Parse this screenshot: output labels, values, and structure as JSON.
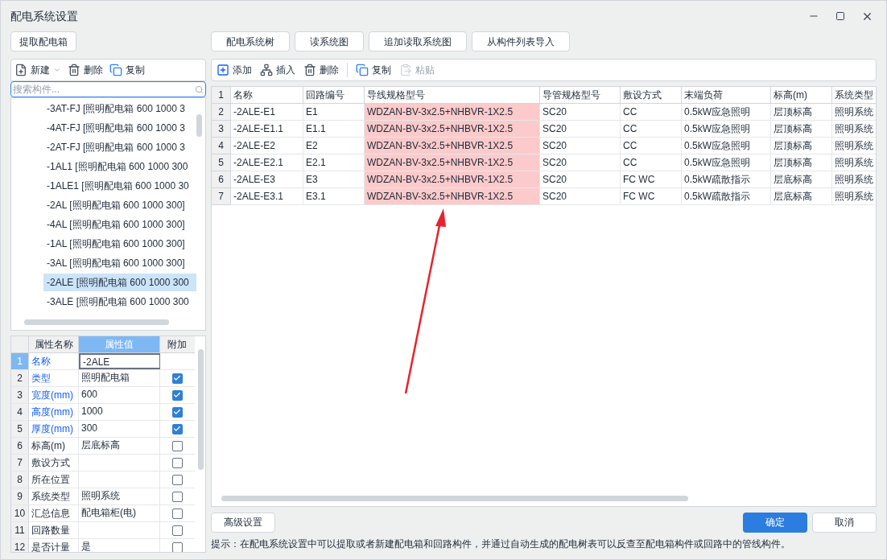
{
  "window": {
    "title": "配电系统设置"
  },
  "left": {
    "extract_button": "提取配电箱",
    "toolbar": [
      {
        "kind": "new",
        "label": "新建",
        "dropdown": true
      },
      {
        "kind": "delete",
        "label": "删除",
        "dropdown": false
      },
      {
        "kind": "copy",
        "label": "复制",
        "dropdown": false
      }
    ],
    "search": {
      "placeholder": "搜索构件..."
    },
    "tree": [
      {
        "label": "-3AT-FJ [照明配电箱 600 1000 3",
        "selected": false
      },
      {
        "label": "-4AT-FJ [照明配电箱 600 1000 3",
        "selected": false
      },
      {
        "label": "-2AT-FJ [照明配电箱 600 1000 3",
        "selected": false
      },
      {
        "label": "-1AL1 [照明配电箱 600 1000 300",
        "selected": false
      },
      {
        "label": "-1ALE1 [照明配电箱 600 1000 30",
        "selected": false
      },
      {
        "label": "-2AL [照明配电箱 600 1000 300]",
        "selected": false
      },
      {
        "label": "-4AL [照明配电箱 600 1000 300]",
        "selected": false
      },
      {
        "label": "-1AL [照明配电箱 600 1000 300]",
        "selected": false
      },
      {
        "label": "-3AL [照明配电箱 600 1000 300]",
        "selected": false
      },
      {
        "label": "-2ALE [照明配电箱 600 1000 300",
        "selected": true
      },
      {
        "label": "-3ALE [照明配电箱 600 1000 300",
        "selected": false
      }
    ],
    "properties": {
      "columns": [
        "属性名称",
        "属性值",
        "附加"
      ],
      "rows": [
        {
          "index": "1",
          "name": "名称",
          "value": "-2ALE",
          "required": true,
          "selected": true
        },
        {
          "index": "2",
          "name": "类型",
          "value": "照明配电箱",
          "required": true,
          "checked": true,
          "selected": false
        },
        {
          "index": "3",
          "name": "宽度(mm)",
          "value": "600",
          "required": true,
          "checked": true,
          "selected": false
        },
        {
          "index": "4",
          "name": "高度(mm)",
          "value": "1000",
          "required": true,
          "checked": true,
          "selected": false
        },
        {
          "index": "5",
          "name": "厚度(mm)",
          "value": "300",
          "required": true,
          "checked": true,
          "selected": false
        },
        {
          "index": "6",
          "name": "标高(m)",
          "value": "层底标高",
          "required": false,
          "checked": false,
          "selected": false
        },
        {
          "index": "7",
          "name": "敷设方式",
          "required": false,
          "checked": false,
          "selected": false
        },
        {
          "index": "8",
          "name": "所在位置",
          "required": false,
          "checked": false,
          "selected": false
        },
        {
          "index": "9",
          "name": "系统类型",
          "value": "照明系统",
          "required": false,
          "checked": false,
          "selected": false
        },
        {
          "index": "10",
          "name": "汇总信息",
          "value": "配电箱柜(电)",
          "required": false,
          "checked": false,
          "selected": false
        },
        {
          "index": "11",
          "name": "回路数量",
          "required": false,
          "checked": false,
          "selected": false
        },
        {
          "index": "12",
          "name": "是否计量",
          "value": "是",
          "required": false,
          "checked": false,
          "selected": false
        }
      ]
    }
  },
  "right": {
    "top_buttons": [
      "配电系统树",
      "读系统图",
      "追加读取系统图",
      "从构件列表导入"
    ],
    "toolbar": [
      {
        "kind": "add",
        "label": "添加",
        "disabled": false
      },
      {
        "kind": "insert",
        "label": "插入",
        "disabled": false
      },
      {
        "kind": "delete",
        "label": "删除",
        "disabled": false
      },
      {
        "kind": "copy",
        "label": "复制",
        "disabled": false
      },
      {
        "kind": "paste",
        "label": "粘贴",
        "disabled": true
      }
    ],
    "table": {
      "header_index": "1",
      "columns": [
        {
          "label": "名称",
          "highlighted": false
        },
        {
          "label": "回路编号",
          "highlighted": false
        },
        {
          "label": "导线规格型号",
          "highlighted": true
        },
        {
          "label": "导管规格型号",
          "highlighted": false
        },
        {
          "label": "敷设方式",
          "highlighted": false
        },
        {
          "label": "末端负荷",
          "highlighted": false
        },
        {
          "label": "标高(m)",
          "highlighted": false
        },
        {
          "label": "系统类型",
          "highlighted": false
        }
      ],
      "rows": [
        {
          "index": "2",
          "cells": [
            "-2ALE-E1",
            "E1",
            "WDZAN-BV-3x2.5+NHBVR-1X2.5",
            "SC20",
            "CC",
            "0.5kW应急照明",
            "层顶标高",
            "照明系统"
          ]
        },
        {
          "index": "3",
          "cells": [
            "-2ALE-E1.1",
            "E1.1",
            "WDZAN-BV-3x2.5+NHBVR-1X2.5",
            "SC20",
            "CC",
            "0.5kW应急照明",
            "层顶标高",
            "照明系统"
          ]
        },
        {
          "index": "4",
          "cells": [
            "-2ALE-E2",
            "E2",
            "WDZAN-BV-3x2.5+NHBVR-1X2.5",
            "SC20",
            "CC",
            "0.5kW应急照明",
            "层顶标高",
            "照明系统"
          ]
        },
        {
          "index": "5",
          "cells": [
            "-2ALE-E2.1",
            "E2.1",
            "WDZAN-BV-3x2.5+NHBVR-1X2.5",
            "SC20",
            "CC",
            "0.5kW应急照明",
            "层顶标高",
            "照明系统"
          ]
        },
        {
          "index": "6",
          "cells": [
            "-2ALE-E3",
            "E3",
            "WDZAN-BV-3x2.5+NHBVR-1X2.5",
            "SC20",
            "FC WC",
            "0.5kW疏散指示",
            "层底标高",
            "照明系统"
          ]
        },
        {
          "index": "7",
          "cells": [
            "-2ALE-E3.1",
            "E3.1",
            "WDZAN-BV-3x2.5+NHBVR-1X2.5",
            "SC20",
            "FC WC",
            "0.5kW疏散指示",
            "层底标高",
            "照明系统"
          ]
        }
      ]
    }
  },
  "footer": {
    "advanced_button": "高级设置",
    "ok_button": "确定",
    "cancel_button": "取消",
    "hint": "提示：在配电系统设置中可以提取或者新建配电箱和回路构件，并通过自动生成的配电树表可以反查至配电箱构件或回路中的管线构件。"
  }
}
